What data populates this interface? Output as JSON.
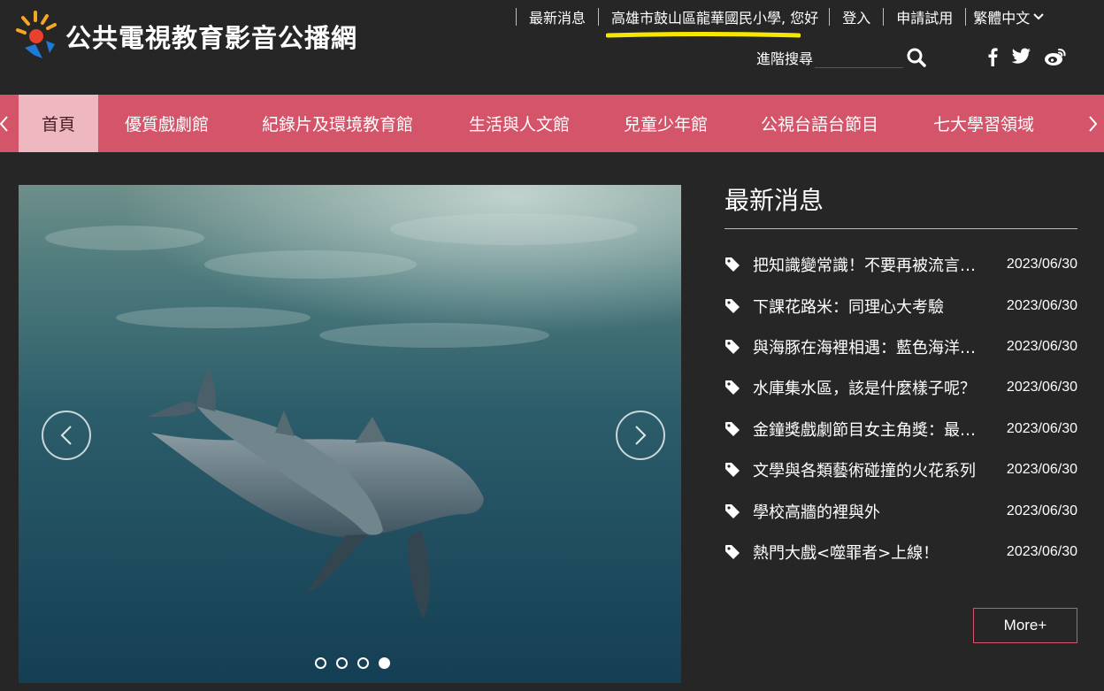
{
  "brand": {
    "title": "公共電視教育影音公播網"
  },
  "topnav": {
    "latest_news": "最新消息",
    "user_greeting": "高雄市鼓山區龍華國民小學, 您好",
    "login": "登入",
    "apply_trial": "申請試用",
    "language": "繁體中文"
  },
  "search": {
    "label": "進階搜尋",
    "placeholder": ""
  },
  "social": {
    "icons": [
      "facebook-icon",
      "twitter-icon",
      "weibo-icon"
    ]
  },
  "categories": [
    {
      "label": "首頁",
      "active": true
    },
    {
      "label": "優質戲劇館"
    },
    {
      "label": "紀錄片及環境教育館"
    },
    {
      "label": "生活與人文館"
    },
    {
      "label": "兒童少年館"
    },
    {
      "label": "公視台語台節目"
    },
    {
      "label": "七大學習領域"
    }
  ],
  "carousel": {
    "slide_count": 4,
    "active_slide": 4
  },
  "news": {
    "heading": "最新消息",
    "items": [
      {
        "text": "把知識變常識！不要再被流言騙了",
        "date": "2023/06/30"
      },
      {
        "text": "下課花路米：同理心大考驗",
        "date": "2023/06/30"
      },
      {
        "text": "與海豚在海裡相遇：藍色海洋的守護者",
        "date": "2023/06/30"
      },
      {
        "text": "水庫集水區，該是什麼樣子呢？",
        "date": "2023/06/30"
      },
      {
        "text": "金鐘獎戲劇節目女主角獎：最佳演出",
        "date": "2023/06/30"
      },
      {
        "text": "文學與各類藝術碰撞的火花系列",
        "date": "2023/06/30"
      },
      {
        "text": "學校高牆的裡與外",
        "date": "2023/06/30"
      },
      {
        "text": "熱門大戲<噬罪者>上線！",
        "date": "2023/06/30"
      }
    ],
    "more_label": "More+"
  },
  "colors": {
    "background": "#262626",
    "accent": "#d4546a",
    "active_tab": "#efb8c1",
    "highlight": "#f7e600"
  }
}
